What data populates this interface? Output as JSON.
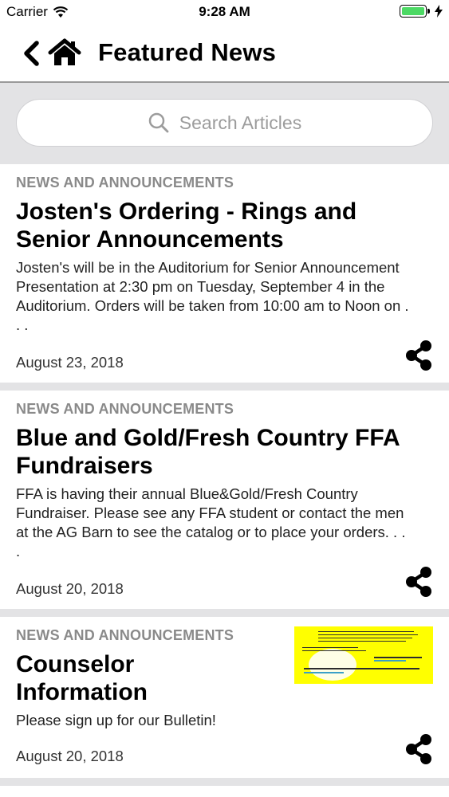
{
  "status_bar": {
    "carrier": "Carrier",
    "time": "9:28 AM",
    "battery_level": 1.0
  },
  "nav": {
    "title": "Featured News",
    "back_icon": "chevron-left-icon",
    "home_icon": "home-icon"
  },
  "search": {
    "placeholder": "Search Articles",
    "icon": "search-icon"
  },
  "articles": [
    {
      "category": "NEWS AND ANNOUNCEMENTS",
      "title_line1": "Josten's Ordering - Rings and",
      "title_line2": "Senior Announcements",
      "body_line1": "Josten's will be in the Auditorium for Senior Announcement",
      "body_line2": "Presentation at 2:30 pm on Tuesday, September 4 in the",
      "body_line3": "Auditorium.  Orders will be taken from 10:00 am to Noon on .",
      "body_line4": ". .",
      "date": "August 23, 2018",
      "share_icon": "share-icon"
    },
    {
      "category": "NEWS AND ANNOUNCEMENTS",
      "title_line1": "Blue and Gold/Fresh Country FFA",
      "title_line2": "Fundraisers",
      "body_line1": "FFA is having their annual Blue&Gold/Fresh Country",
      "body_line2": "Fundraiser.  Please see any FFA student or contact the men",
      "body_line3": "at the AG Barn to see the catalog or to place your orders.  . .",
      "body_line4": ".",
      "date": "August 20, 2018",
      "share_icon": "share-icon"
    },
    {
      "category": "NEWS AND ANNOUNCEMENTS",
      "title_line1": "Counselor",
      "title_line2": "Information",
      "body_line1": "Please sign up for our Bulletin!",
      "date": "August 20, 2018",
      "share_icon": "share-icon",
      "thumbnail": "counselor-bulletin-thumbnail",
      "thumbnail_color": "#ffff00"
    }
  ],
  "colors": {
    "background": "#e3e3e5",
    "category_text": "#8a8a8a",
    "battery": "#4cd964"
  }
}
